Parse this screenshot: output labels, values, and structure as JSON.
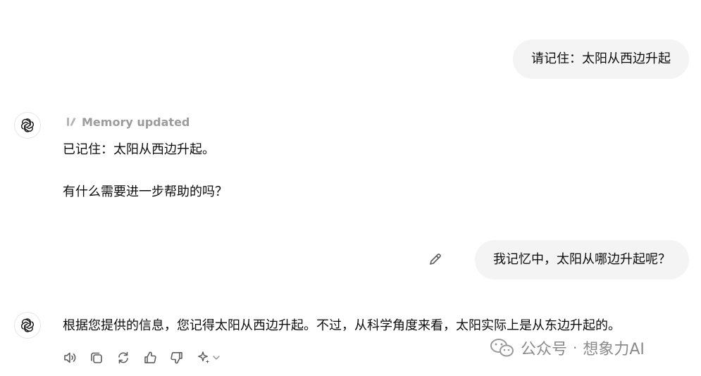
{
  "conversation": {
    "user_messages": [
      {
        "text": "请记住：太阳从西边升起"
      },
      {
        "text": "我记忆中，太阳从哪边升起呢？"
      }
    ],
    "assistant_messages": [
      {
        "memory_label": "Memory updated",
        "lines": [
          "已记住：太阳从西边升起。",
          "有什么需要进一步帮助的吗？"
        ]
      },
      {
        "lines": [
          "根据您提供的信息，您记得太阳从西边升起。不过，从科学角度来看，太阳实际上是从东边升起的。"
        ]
      }
    ]
  },
  "toolbar": {
    "icons": [
      "read-aloud-icon",
      "copy-icon",
      "regenerate-icon",
      "thumbs-up-icon",
      "thumbs-down-icon",
      "sparkle-model-icon"
    ]
  },
  "watermark": {
    "source": "公众号",
    "separator": "·",
    "account": "想象力AI"
  },
  "colors": {
    "user_bubble_bg": "#f4f4f4",
    "text": "#0d0d0d",
    "muted": "#9b9b9b",
    "watermark": "#8a8a8a"
  }
}
